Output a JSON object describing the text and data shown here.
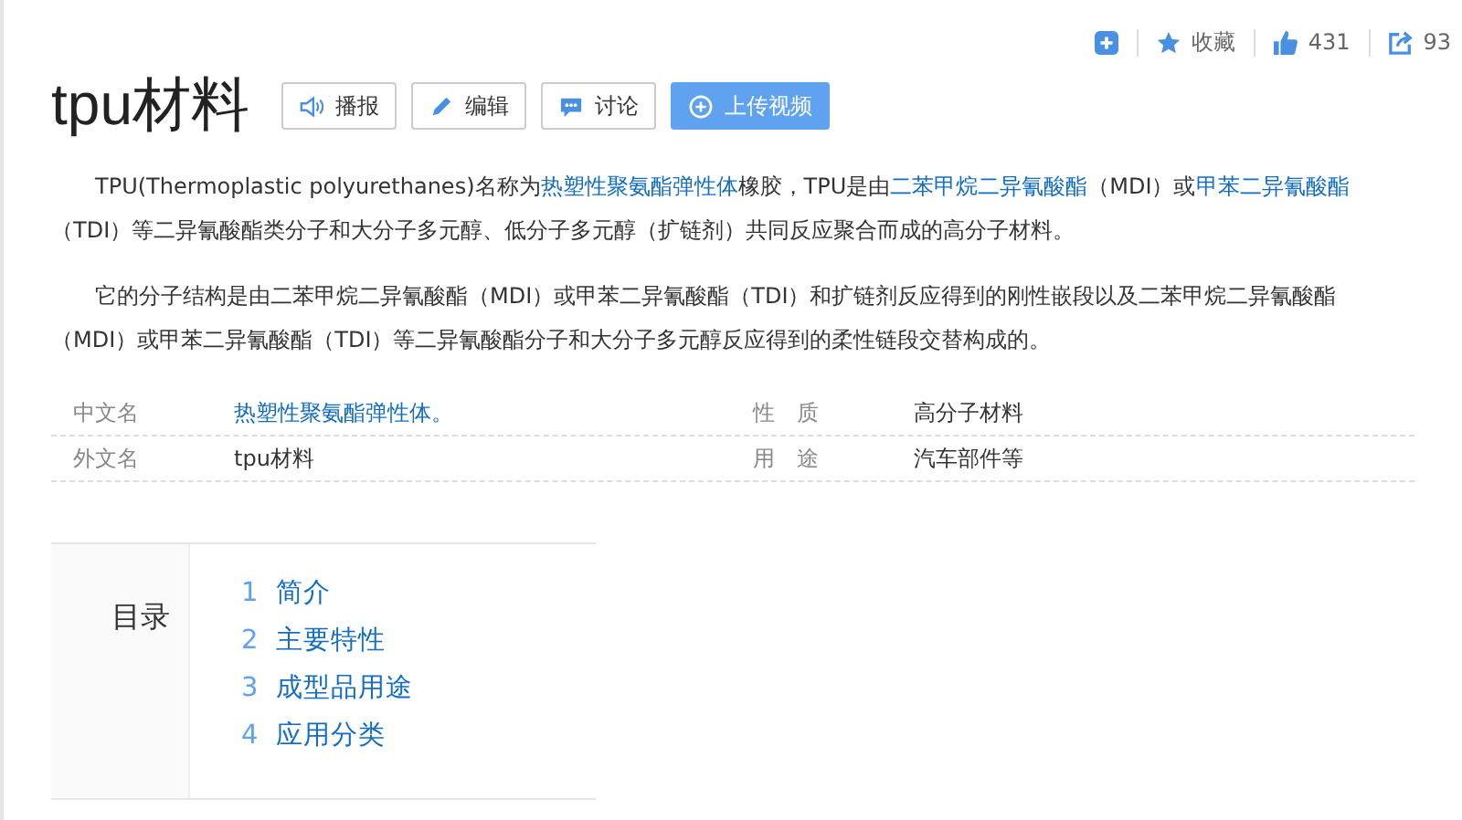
{
  "toolbar": {
    "collect_label": "收藏",
    "likes": "431",
    "shares": "93"
  },
  "title": "tpu材料",
  "actions": [
    {
      "kind": "audio",
      "label": "播报"
    },
    {
      "kind": "edit",
      "label": "编辑"
    },
    {
      "kind": "discuss",
      "label": "讨论"
    },
    {
      "kind": "upload",
      "label": "上传视频"
    }
  ],
  "paragraphs": [
    [
      {
        "kind": "text",
        "text": "TPU(Thermoplastic polyurethanes)名称为"
      },
      {
        "kind": "link",
        "text": "热塑性聚氨酯弹性体"
      },
      {
        "kind": "text",
        "text": "橡胶，TPU是由"
      },
      {
        "kind": "link",
        "text": "二苯甲烷二异氰酸酯"
      },
      {
        "kind": "text",
        "text": "（MDI）或"
      },
      {
        "kind": "link",
        "text": "甲苯二异氰酸酯"
      },
      {
        "kind": "text",
        "text": "（TDI）等二异氰酸酯类分子和大分子多元醇、低分子多元醇（扩链剂）共同反应聚合而成的高分子材料。"
      }
    ],
    [
      {
        "kind": "text",
        "text": "它的分子结构是由二苯甲烷二异氰酸酯（MDI）或甲苯二异氰酸酯（TDI）和扩链剂反应得到的刚性嵌段以及二苯甲烷二异氰酸酯（MDI）或甲苯二异氰酸酯（TDI）等二异氰酸酯分子和大分子多元醇反应得到的柔性链段交替构成的。"
      }
    ]
  ],
  "info": [
    [
      {
        "label": "中文名",
        "value": "热塑性聚氨酯弹性体。",
        "link": true
      },
      {
        "label": "性　质",
        "value": "高分子材料",
        "link": false
      }
    ],
    [
      {
        "label": "外文名",
        "value": "tpu材料",
        "link": false
      },
      {
        "label": "用　途",
        "value": "汽车部件等",
        "link": false
      }
    ]
  ],
  "toc": {
    "heading": "目录",
    "items": [
      {
        "number": "1",
        "label": "简介"
      },
      {
        "number": "2",
        "label": "主要特性"
      },
      {
        "number": "3",
        "label": "成型品用途"
      },
      {
        "number": "4",
        "label": "应用分类"
      }
    ]
  }
}
